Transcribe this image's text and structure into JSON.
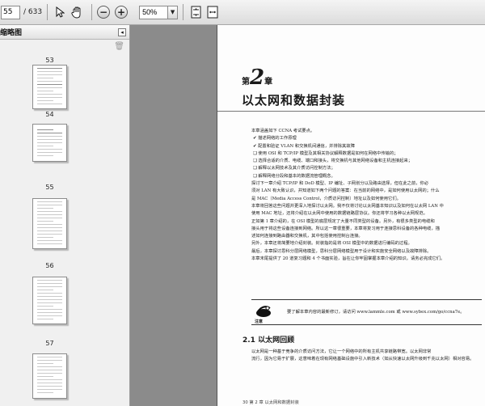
{
  "toolbar": {
    "page_value": "55",
    "page_total": "/ 633",
    "zoom_value": "50%",
    "select_icon": "cursor-select-icon",
    "hand_icon": "hand-tool-icon",
    "zoom_out_icon": "zoom-out-icon",
    "zoom_in_icon": "zoom-in-icon",
    "fit_page_icon": "fit-page-icon",
    "fit_width_icon": "fit-width-icon"
  },
  "sidebar": {
    "title": "缩略图",
    "thumbnails": [
      {
        "label": "53"
      },
      {
        "label": "54"
      },
      {
        "label": "55"
      },
      {
        "label": "56"
      },
      {
        "label": "57"
      }
    ]
  },
  "document": {
    "chapter_prefix": "第",
    "chapter_number": "2",
    "chapter_suffix": "章",
    "chapter_title": "以太网和数据封装",
    "intro_lines": [
      "本章涵盖如下 CCNA 考试要点。",
      "✔ 描述网络的工作原理",
      "✔ 配置和验证 VLAN 和交换机间通信，并排除其故障",
      "❑ 使用 OSI 和 TCP/IP 模型及其相关协议解释数据是如何在网络中传输的；",
      "❑ 选择合适的介质、电缆、端口和接头，将交换机与其他网络设备和主机连接起来；",
      "❑ 解释以太网技术及其介质访问控制方法；",
      "❑ 解释网络分段和基本的数据流管理概念。"
    ],
    "body_lines": [
      "探讨下一章介绍 TCP/IP 和 DoD 模型、IP 编址、子网划分以及路由选择，但在此之前，你必",
      "须对 LAN 有大致认识，并知道如下两个问题的答案：在当前的网络中，是如何使用以太网的；什么",
      "是 MAC（Media Access Control，介质访问控制）地址以及如何使用它们。",
      "本章将回答这些问题并更深入地探讨以太网。我不仅将讨论以太网基本知识以及如何在以太网 LAN 中",
      "使用 MAC 地址，还将介绍在以太网中使用的数据链路层协议。你还将学习各种以太网规范。",
      "正如第 1 章介绍的，在 OSI 模型的底层规定了大量不同类型的设备。另外，有很多类型的电缆和",
      "接头用于将这些设备连接到网络。所以这一章很重要，本章将复习用于连接思科设备的各种电缆，描",
      "述如何连接到路由器和交换机，其中包括使用控制台连接。",
      "另外，本章还将简要地介绍封装。封装指的是将 OSI 模型中的数据进行编码的过程。",
      "最后，本章探讨思科分层网络模型，思科分层网络模型用于设计和实施安全网络以及故障排除。",
      "本章末尾提供了 20 道复习题和 4 个书面实验，旨在让你牢固掌握本章介绍的知识。请务必完成它们。"
    ],
    "note_label": "注意",
    "note_text": "要了解本章内容的最新修订，请访问 www.lammle.com 或 www.sybex.com/go/ccna7e。",
    "section_title": "2.1  以太网回顾",
    "section_lines": [
      "以太网是一种基于竞争的介质访问方法，它让一个网络中的所有主机共享链路带宽。以太网非常",
      "流行，因为它易于扩展，这意味着在现有网络基础设施中引入新技术（如从快速以太网升级到千兆以太网）相对容易。"
    ],
    "footer": "30     第 2 章  以太网和数据封装"
  }
}
